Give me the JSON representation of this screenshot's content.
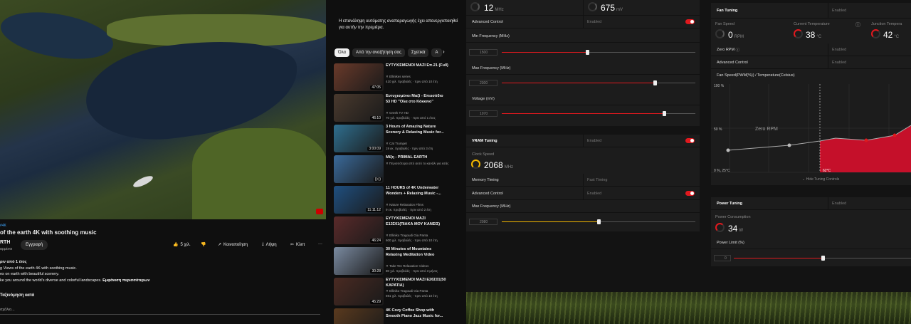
{
  "youtube": {
    "video_tag": "#4K",
    "title": "of the earth 4K with soothing music",
    "channel_name": "RTH",
    "channel_subs": "αρμένοι",
    "subscribe_label": "Εγγραφή",
    "like_count": "5 χιλ.",
    "share_label": "Κοινοποίηση",
    "save_label": "Λήψη",
    "clip_label": "Κλιπ",
    "more_label": "···",
    "desc_line1": "ριν από 1 έτος",
    "desc_line2": "g Views of the earth 4K with soothing music.",
    "desc_line3": "es on earth with beautiful scenery.",
    "desc_line4": "ke you around the world's diverse and colorful landscapes.",
    "desc_more": "Εμφάνιση περισσότερων",
    "sort_label": "Ταξινόμηση κατά",
    "comment_placeholder": "σχόλιο...",
    "autoplay_notice": "Η επανάληψη αυτόματης αναπαραγωγής έχει απενεργοποιηθεί για αυτήν την πρεμιέρα.",
    "chips": [
      "Όλα",
      "Από την αναζήτηση σας",
      "Σχετικά",
      "Α"
    ],
    "recommendations": [
      {
        "title": "ΕΥΤΥΧΙΣΜΕΝΟΙ ΜΑΖΙ Επ.21 (Full)",
        "channel": "Ellinikes seires",
        "meta": "410 χιλ. προβολές · πριν από 10 έτη",
        "duration": "47:05",
        "color": "#6a3a2a"
      },
      {
        "title": "Ευτυχισμένοι Μαζί - Επεισόδιο 53 HD \"Όλα στο Κόκκινο\"",
        "channel": "Greek TV HD",
        "meta": "70 χιλ. προβολές · πριν από 1 έτος",
        "duration": "46:10",
        "color": "#4a3a2e"
      },
      {
        "title": "3 Hours of Amazing Nature Scenery & Relaxing Music for...",
        "channel": "Cat Trumpet",
        "meta": "19 εκ. προβολές · πριν από 3 έτη",
        "duration": "3:00:09",
        "color": "#2f6f8f"
      },
      {
        "title": "Μίξη - PRIMAL EARTH",
        "channel": "Περισσότερα από αυτό το κανάλι για εσάς",
        "meta": "",
        "duration": "((•))",
        "color": "#3a6a9a"
      },
      {
        "title": "11 HOURS of 4K Underwater Wonders + Relaxing Music -...",
        "channel": "Nature Relaxation Films",
        "meta": "9 εκ. προβολές · πριν από 2 έτη",
        "duration": "11:11:12",
        "color": "#1f4f7f"
      },
      {
        "title": "ΕΥΤΥΧΙΣΜΕΝΟΙ ΜΑΖΙ Ε13Σ01(ΠΙΑΚΑ ΜΟΥ ΚΑΝΕΙΣ)",
        "channel": "Elliniko Tragoudi Gia Panta",
        "meta": "600 χιλ. προβολές · πριν από 10 έτη",
        "duration": "46:24",
        "color": "#5a2a2a"
      },
      {
        "title": "30 Minutes of Mountains Relaxing Meditation Video",
        "channel": "Take Ten Relaxation Videos",
        "meta": "80 χιλ. προβολές · πριν από 3 μήνες",
        "duration": "30:28",
        "color": "#7a8aa0"
      },
      {
        "title": "ΕΥΤΥΧΙΣΜΕΝΟΙ ΜΑΖΙ Ε26Σ01(50 ΚΑΡΑΤΙΑ)",
        "channel": "Elliniko Tragoudi Gia Panta",
        "meta": "691 χιλ. προβολές · πριν από 10 έτη",
        "duration": "45:29",
        "color": "#4a2a22"
      },
      {
        "title": "4K Cozy Coffee Shop with Smooth Piano Jazz Music for...",
        "channel": "Relaxing Jazz Piano",
        "meta": "",
        "duration": "",
        "color": "#5a3a1e"
      }
    ]
  },
  "gpu": {
    "top_val1": "12",
    "top_unit1": "MHz",
    "top_val2": "675",
    "top_unit2": "mV",
    "advanced_control_label": "Advanced Control",
    "enabled": "Enabled",
    "min_freq_label": "Min Frequency (MHz)",
    "min_freq_value": "1500",
    "min_freq_pct": 0.44,
    "max_freq_label": "Max Frequency (MHz)",
    "max_freq_value": "2300",
    "max_freq_pct": 0.79,
    "voltage_label": "Voltage (mV)",
    "voltage_value": "1070",
    "voltage_pct": 0.84,
    "vram_title": "VRAM Tuning",
    "clock_speed_label": "Clock Speed",
    "clock_speed_value": "2068",
    "clock_speed_unit": "MHz",
    "memory_timing_label": "Memory Timing",
    "memory_timing_value": "Fast Timing",
    "vram_max_freq_label": "Max Frequency (MHz)",
    "vram_max_freq_value": "2080",
    "vram_max_freq_pct": 0.5
  },
  "fan": {
    "title": "Fan Tuning",
    "enabled": "Enabled",
    "fan_speed_label": "Fan Speed",
    "fan_speed_value": "0",
    "fan_speed_unit": "RPM",
    "current_temp_label": "Current Temperature",
    "current_temp_value": "38",
    "temp_unit": "°C",
    "junction_temp_label": "Junction Tempera",
    "junction_temp_value": "42",
    "zero_rpm_label": "Zero RPM",
    "advanced_control_label": "Advanced Control",
    "curve_label": "Fan Speed(PWM(%)) / Temperature(Celsius)",
    "y_top": "100 %",
    "y_mid": "50 %",
    "y_bottom": "0 %, 25°C",
    "zero_rpm_zone": "Zero RPM",
    "marker_temp": "62°C",
    "hide_curve": "Hide Tuning Controls",
    "power_title": "Power Tuning",
    "power_consumption_label": "Power Consumption",
    "power_value": "34",
    "power_unit": "W",
    "power_limit_label": "Power Limit (%)",
    "power_limit_value": "0",
    "power_limit_pct": 0.5
  },
  "colors": {
    "accent": "#e0191e",
    "vram_accent": "#f5b800",
    "yt_link": "#3ea6ff"
  }
}
